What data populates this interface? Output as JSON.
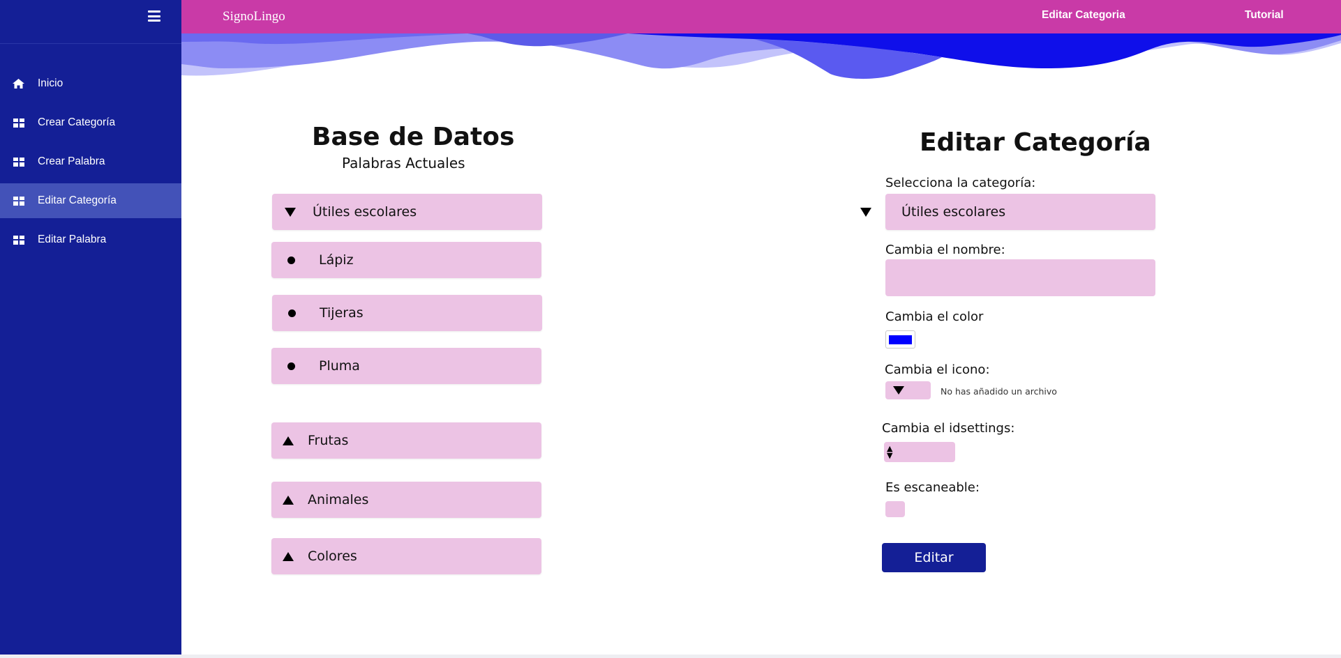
{
  "app": {
    "brand": "SignoLingo"
  },
  "topbar": {
    "links": [
      "Editar Categoria",
      "Tutorial"
    ]
  },
  "sidebar": {
    "menu_icon": "hamburger-icon",
    "items": [
      {
        "label": "Inicio",
        "icon": "home-icon",
        "active": false
      },
      {
        "label": "Crear Categoría",
        "icon": "grid-icon",
        "active": false
      },
      {
        "label": "Crear Palabra",
        "icon": "grid-icon",
        "active": false
      },
      {
        "label": "Editar Categoría",
        "icon": "grid-icon",
        "active": true
      },
      {
        "label": "Editar Palabra",
        "icon": "grid-icon",
        "active": false
      }
    ]
  },
  "database": {
    "title": "Base de Datos",
    "subtitle": "Palabras Actuales",
    "expanded_category": "Útiles escolares",
    "words": [
      "Lápiz",
      "Tijeras",
      "Pluma"
    ],
    "collapsed_categories": [
      "Frutas",
      "Animales",
      "Colores"
    ]
  },
  "edit_form": {
    "title": "Editar Categoría",
    "select_label": "Selecciona la categoría:",
    "select_value": "Útiles escolares",
    "name_label": "Cambia el nombre:",
    "name_value": "",
    "color_label": "Cambia el color",
    "color_value": "#0000ff",
    "icon_label": "Cambia el icono:",
    "file_status": "No has añadido un archivo",
    "idsettings_label": "Cambia el idsettings:",
    "idsettings_value": "",
    "scannable_label": "Es escaneable:",
    "scannable_checked": false,
    "submit_label": "Editar"
  },
  "colors": {
    "sidebar": "#141f96",
    "sidebar_active": "#4352b8",
    "topbar": "#c93aa7",
    "pill": "#ecc3e4",
    "button": "#141f96"
  }
}
